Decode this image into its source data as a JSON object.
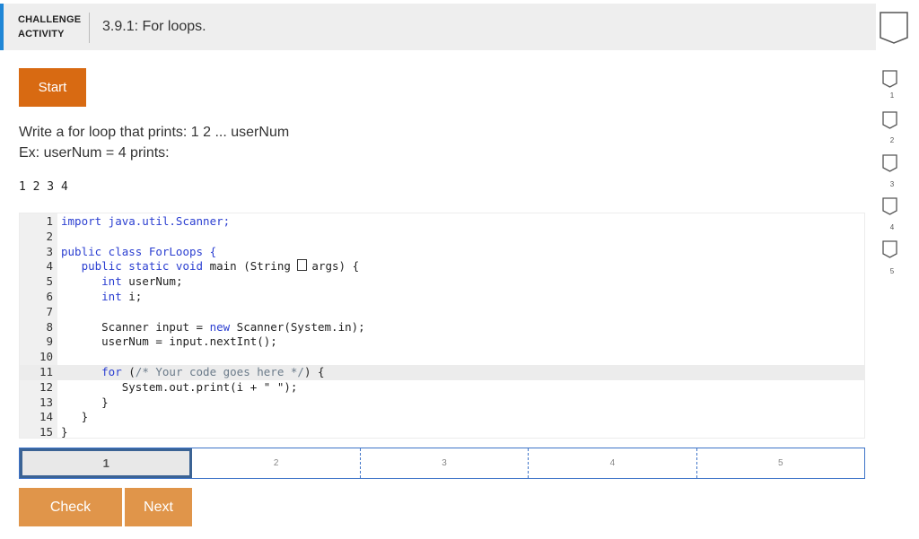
{
  "header": {
    "label_line1": "CHALLENGE",
    "label_line2": "ACTIVITY",
    "title": "3.9.1: For loops."
  },
  "start_label": "Start",
  "prompt": {
    "line1": "Write a for loop that prints: 1 2 ... userNum",
    "line2": "Ex: userNum = 4 prints:",
    "example_output": "1 2 3 4"
  },
  "code": {
    "line_numbers": [
      "1",
      "2",
      "3",
      "4",
      "5",
      "6",
      "7",
      "8",
      "9",
      "10",
      "11",
      "12",
      "13",
      "14",
      "15"
    ],
    "line1": "import java.util.Scanner;",
    "line3": "public class ForLoops {",
    "line4_kw": "public static void",
    "line4_rest": "main (String ",
    "line4_end": "args) {",
    "line5_kw": "int",
    "line5_rest": "userNum;",
    "line6_kw": "int",
    "line6_rest": "i;",
    "line8_a": "Scanner input = ",
    "line8_kw": "new",
    "line8_b": " Scanner(System.in);",
    "line9": "userNum = input.nextInt();",
    "line11_kw": "for",
    "line11_a": " (",
    "line11_cm": "/* Your code goes here */",
    "line11_b": ") {",
    "line12": "System.out.print(i + \" \");",
    "line13": "}",
    "line14": "}",
    "line15": "}"
  },
  "steps": [
    "1",
    "2",
    "3",
    "4",
    "5"
  ],
  "check_label": "Check",
  "next_label": "Next",
  "levels": [
    "1",
    "2",
    "3",
    "4",
    "5"
  ],
  "colors": {
    "accent_blue": "#1f86d6",
    "start_orange": "#d86a12",
    "button_orange": "#e0954a",
    "step_border": "#3d73c8"
  }
}
